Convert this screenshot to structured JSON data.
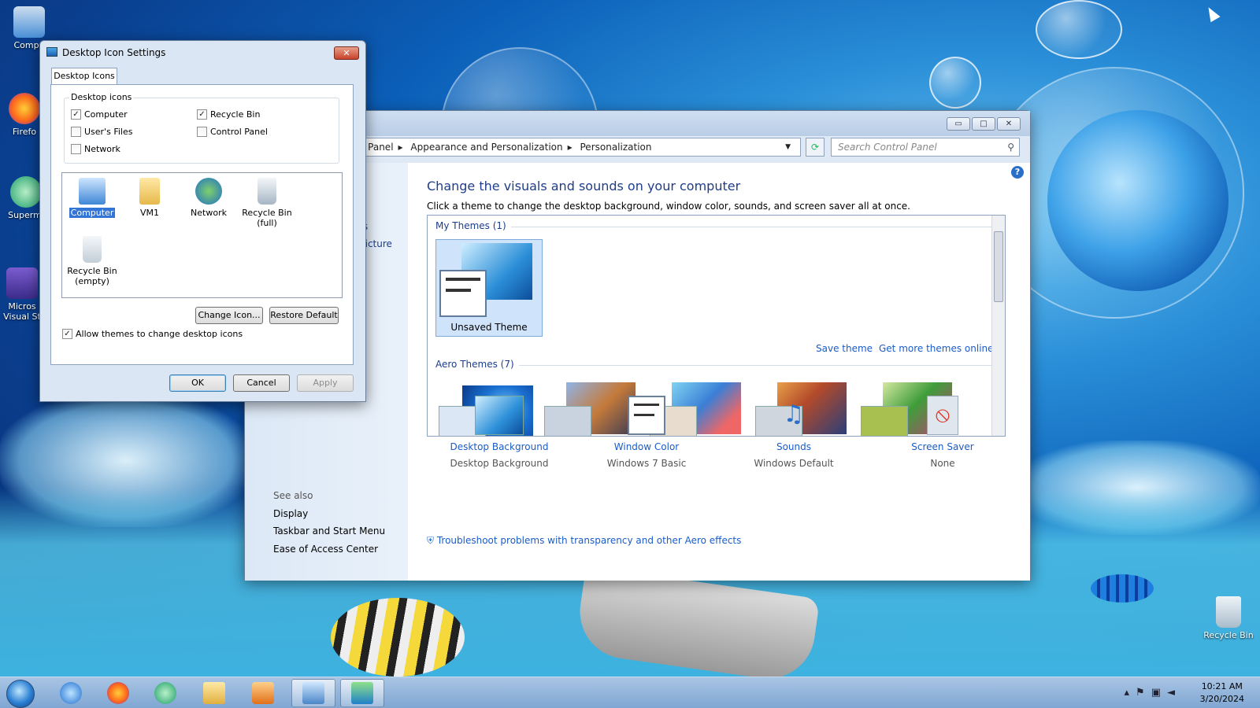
{
  "desktop": {
    "icons_left": [
      {
        "label": "Compu"
      },
      {
        "label": "Firefo"
      },
      {
        "label": "Supermi"
      },
      {
        "label": "Micros Visual St"
      }
    ],
    "recycle_bin": "Recycle Bin"
  },
  "main_window": {
    "breadcrumb": [
      "l Panel",
      "Appearance and Personalization",
      "Personalization"
    ],
    "search_placeholder": "Search Control Panel",
    "caption": {
      "minimize": "▭",
      "maximize": "□",
      "close": "✕"
    },
    "left_fragments": [
      "rs",
      "picture"
    ],
    "heading": "Change the visuals and sounds on your computer",
    "subtitle": "Click a theme to change the desktop background, window color, sounds, and screen saver all at once.",
    "my_themes_label": "My Themes (1)",
    "selected_theme": "Unsaved Theme",
    "save_theme": "Save theme",
    "get_more": "Get more themes online",
    "aero_label": "Aero Themes (7)",
    "items": [
      {
        "name": "Desktop Background",
        "value": "Desktop Background"
      },
      {
        "name": "Window Color",
        "value": "Windows 7 Basic"
      },
      {
        "name": "Sounds",
        "value": "Windows Default"
      },
      {
        "name": "Screen Saver",
        "value": "None"
      }
    ],
    "troubleshoot": "Troubleshoot problems with transparency and other Aero effects",
    "see_also": {
      "title": "See also",
      "links": [
        "Display",
        "Taskbar and Start Menu",
        "Ease of Access Center"
      ]
    }
  },
  "dialog": {
    "title": "Desktop Icon Settings",
    "close": "✕",
    "tab": "Desktop Icons",
    "group_label": "Desktop icons",
    "checkboxes": [
      {
        "label": "Computer",
        "checked": true
      },
      {
        "label": "Recycle Bin",
        "checked": true
      },
      {
        "label": "User's Files",
        "checked": false
      },
      {
        "label": "Control Panel",
        "checked": false
      },
      {
        "label": "Network",
        "checked": false
      }
    ],
    "icons": [
      "Computer",
      "VM1",
      "Network",
      "Recycle Bin (full)",
      "Recycle Bin (empty)"
    ],
    "change_icon": "Change Icon...",
    "restore_default": "Restore Default",
    "allow_themes": "Allow themes to change desktop icons",
    "ok": "OK",
    "cancel": "Cancel",
    "apply": "Apply"
  },
  "taskbar": {
    "time": "10:21 AM",
    "date": "3/20/2024"
  },
  "colors": {
    "link": "#1a5cc8",
    "heading": "#1e3d8a",
    "selection": "#3375d6"
  }
}
